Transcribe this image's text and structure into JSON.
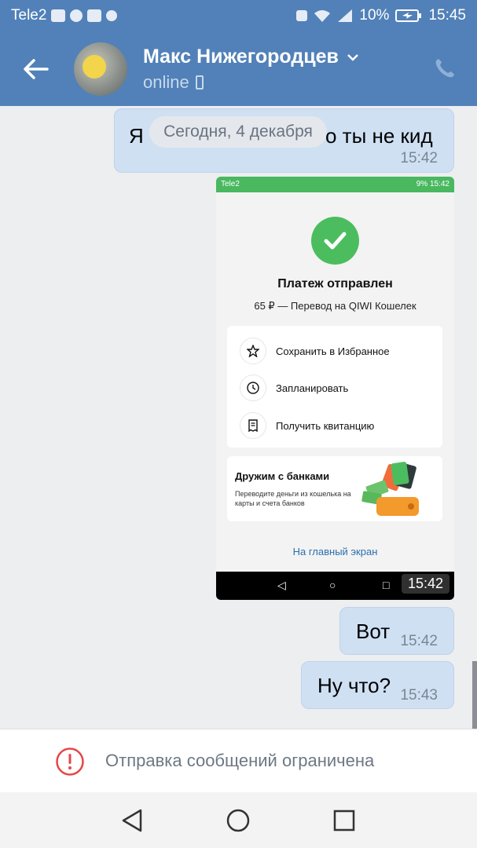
{
  "status_bar": {
    "carrier": "Tele2",
    "battery": "10%",
    "time": "15:45",
    "icons": [
      "activity-icon",
      "chat-icon",
      "youtube-icon",
      "search-icon",
      "nfc-icon",
      "wifi-icon",
      "signal-icon",
      "battery-icon"
    ]
  },
  "header": {
    "contact_name": "Макс Нижегородцев",
    "status": "online",
    "icons": [
      "back-arrow-icon",
      "chevron-down-icon",
      "phone-call-icon",
      "mobile-device-icon"
    ]
  },
  "chat": {
    "date_divider": "Сегодня, 4 декабря",
    "messages": [
      {
        "text_prefix": "Я",
        "text_suffix": "о ты не кид",
        "time": "15:42"
      },
      {
        "type": "image",
        "time": "15:42"
      },
      {
        "text": "Вот",
        "time": "15:42"
      },
      {
        "text": "Ну что?",
        "time": "15:43"
      }
    ],
    "attachment": {
      "status_carrier": "Tele2",
      "status_right": "9%",
      "status_time": "15:42",
      "title": "Платеж отправлен",
      "subtitle": "65 ₽ — Перевод на QIWI Кошелек",
      "actions": [
        "Сохранить в Избранное",
        "Запланировать",
        "Получить квитанцию"
      ],
      "promo_title": "Дружим с банками",
      "promo_text": "Переводите деньги из кошелька на карты и счета банков",
      "home_link": "На главный экран",
      "accent": "#4cbd5f"
    }
  },
  "restriction": {
    "text": "Отправка сообщений ограничена",
    "icon": "warning-circle-icon",
    "color": "#e64646"
  },
  "navbar": {
    "buttons": [
      "back-triangle-icon",
      "home-circle-icon",
      "recents-square-icon"
    ]
  },
  "colors": {
    "brand": "#5181b8",
    "bubble": "#cfe0f3"
  }
}
